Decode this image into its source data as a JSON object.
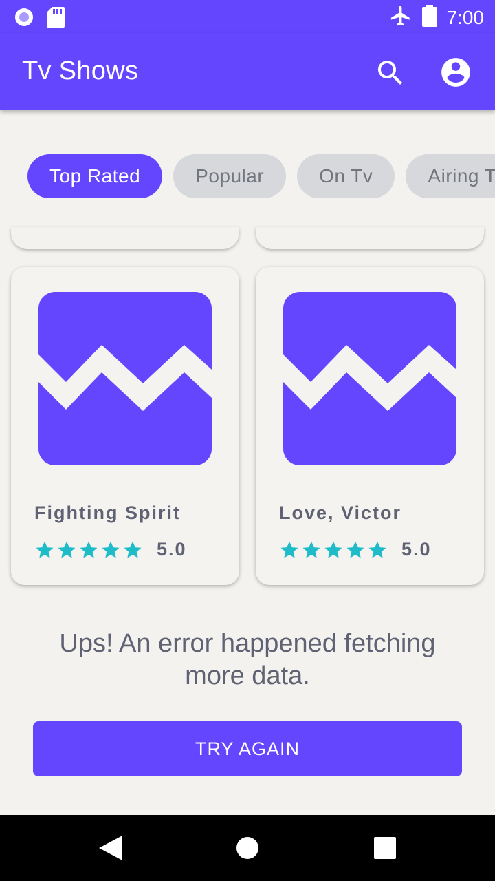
{
  "status_bar": {
    "time": "7:00",
    "icons": [
      "notification-dot-icon",
      "sd-card-icon",
      "airplane-icon",
      "battery-icon"
    ]
  },
  "app_bar": {
    "title": "Tv Shows",
    "actions": [
      "search-icon",
      "account-icon"
    ]
  },
  "chips": [
    {
      "label": "Top Rated",
      "active": true
    },
    {
      "label": "Popular",
      "active": false
    },
    {
      "label": "On Tv",
      "active": false
    },
    {
      "label": "Airing T",
      "active": false
    }
  ],
  "shows": [
    {
      "title": "Fighting Spirit",
      "rating": "5.0",
      "stars": 5
    },
    {
      "title": "Love, Victor",
      "rating": "5.0",
      "stars": 5
    }
  ],
  "error": {
    "message": "Ups! An error happened fetching more data.",
    "retry_label": "TRY AGAIN"
  },
  "colors": {
    "primary": "#6446ff",
    "background": "#f3f2ef",
    "chip_inactive": "#d6d8db",
    "text_secondary": "#5f6272",
    "star": "#1ebcc8"
  },
  "nav_bar": {
    "buttons": [
      "back-icon",
      "home-icon",
      "recents-icon"
    ]
  }
}
